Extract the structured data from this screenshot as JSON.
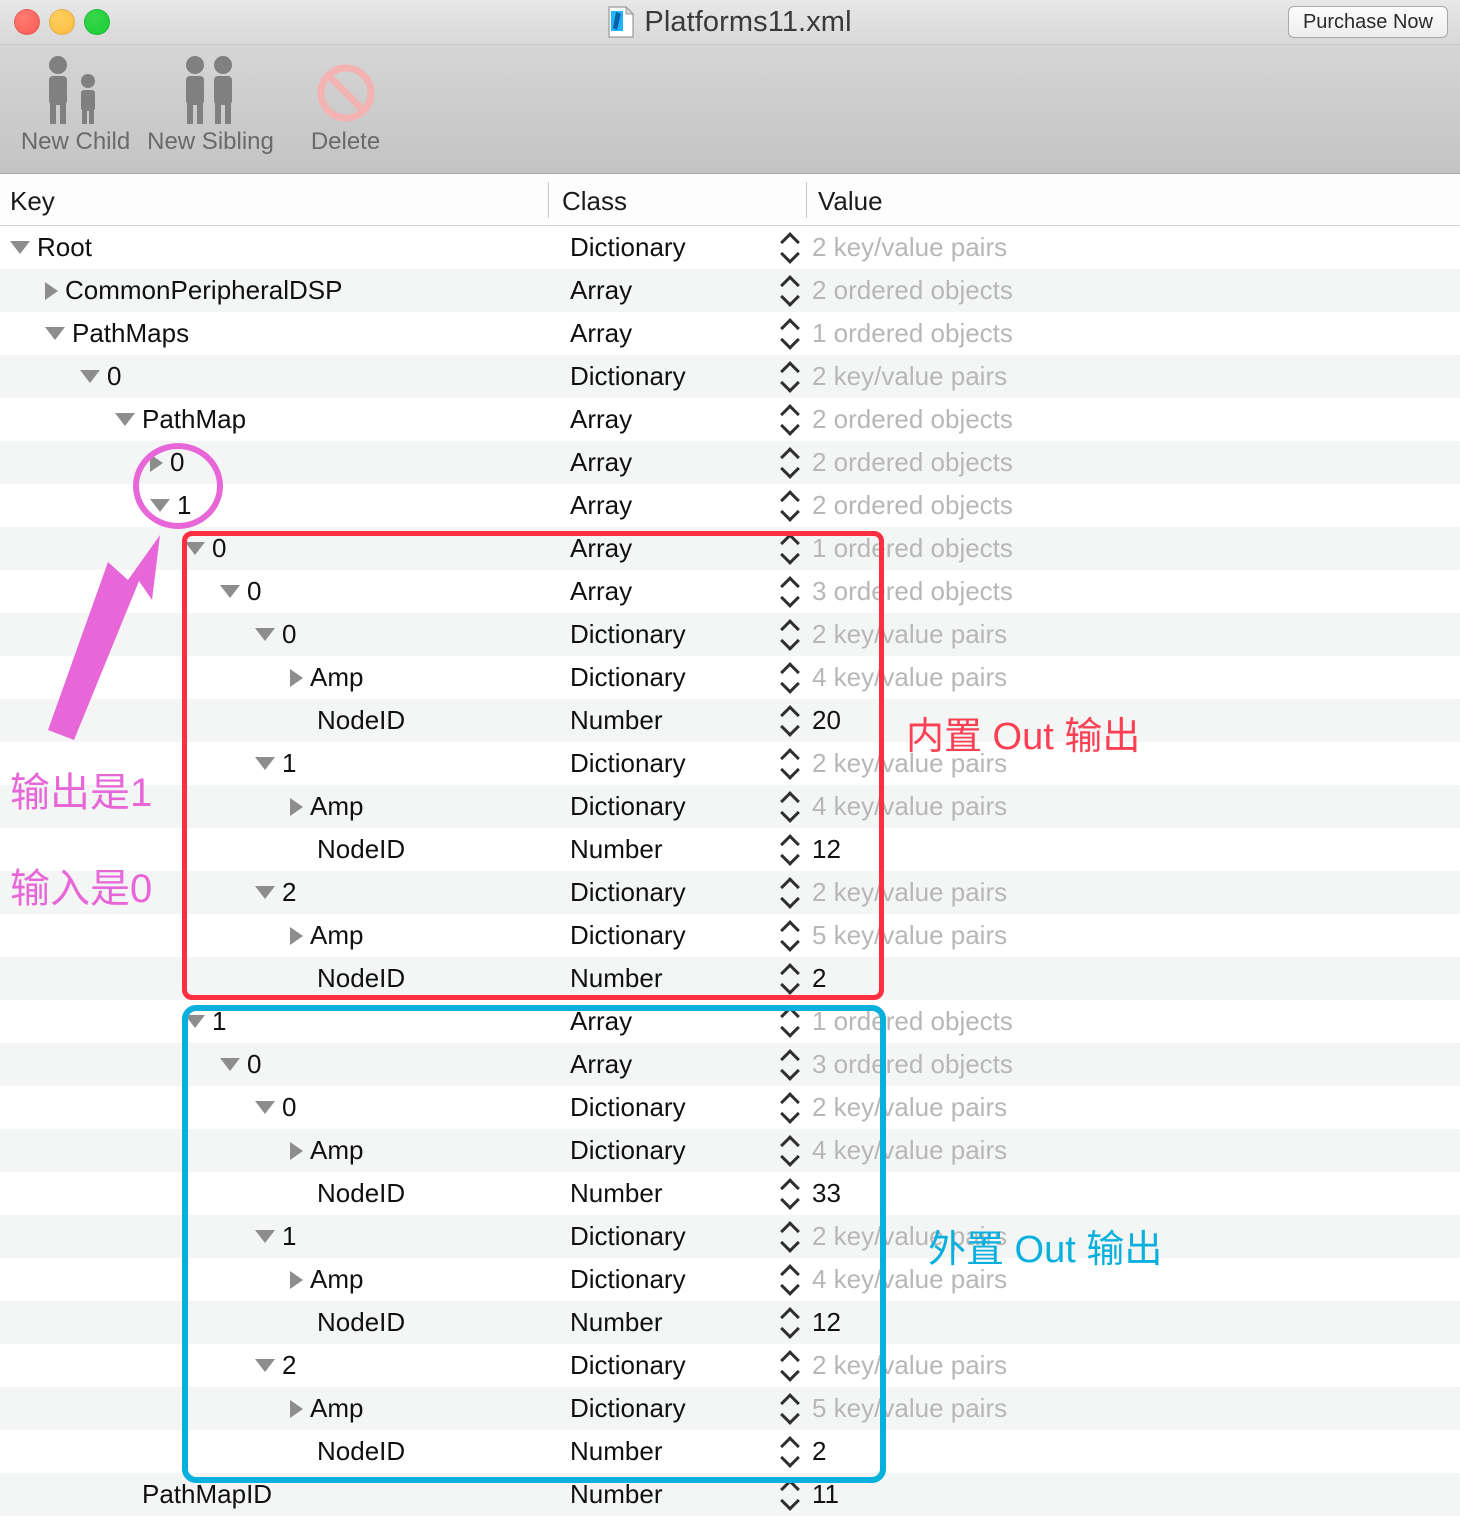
{
  "window": {
    "title": "Platforms11.xml",
    "title_icon": "xml-document-icon",
    "purchase_label": "Purchase Now",
    "traffic_lights": [
      "close-button",
      "minimize-button",
      "zoom-button"
    ]
  },
  "toolbar": {
    "items": [
      {
        "label": "New Child",
        "icon": "two-people-parent-child-icon"
      },
      {
        "label": "New Sibling",
        "icon": "two-people-icon"
      },
      {
        "label": "Delete",
        "icon": "prohibition-sign-icon"
      }
    ]
  },
  "table": {
    "columns": [
      "Key",
      "Class",
      "Value"
    ],
    "rows": [
      {
        "indent": 0,
        "disc": "open",
        "key": "Root",
        "cls": "Dictionary",
        "val": "2 key/value pairs",
        "muted": true,
        "stepper": true
      },
      {
        "indent": 1,
        "disc": "closed",
        "key": "CommonPeripheralDSP",
        "cls": "Array",
        "val": "2 ordered objects",
        "muted": true,
        "stepper": true
      },
      {
        "indent": 1,
        "disc": "open",
        "key": "PathMaps",
        "cls": "Array",
        "val": "1 ordered objects",
        "muted": true,
        "stepper": true
      },
      {
        "indent": 2,
        "disc": "open",
        "key": "0",
        "cls": "Dictionary",
        "val": "2 key/value pairs",
        "muted": true,
        "stepper": true
      },
      {
        "indent": 3,
        "disc": "open",
        "key": "PathMap",
        "cls": "Array",
        "val": "2 ordered objects",
        "muted": true,
        "stepper": true
      },
      {
        "indent": 4,
        "disc": "closed",
        "key": "0",
        "cls": "Array",
        "val": "2 ordered objects",
        "muted": true,
        "stepper": true
      },
      {
        "indent": 4,
        "disc": "open",
        "key": "1",
        "cls": "Array",
        "val": "2 ordered objects",
        "muted": true,
        "stepper": true
      },
      {
        "indent": 5,
        "disc": "open",
        "key": "0",
        "cls": "Array",
        "val": "1 ordered objects",
        "muted": true,
        "stepper": true
      },
      {
        "indent": 6,
        "disc": "open",
        "key": "0",
        "cls": "Array",
        "val": "3 ordered objects",
        "muted": true,
        "stepper": true
      },
      {
        "indent": 7,
        "disc": "open",
        "key": "0",
        "cls": "Dictionary",
        "val": "2 key/value pairs",
        "muted": true,
        "stepper": true
      },
      {
        "indent": 8,
        "disc": "closed",
        "key": "Amp",
        "cls": "Dictionary",
        "val": "4 key/value pairs",
        "muted": true,
        "stepper": true
      },
      {
        "indent": 8,
        "disc": "none",
        "key": "NodeID",
        "cls": "Number",
        "val": "20",
        "muted": false,
        "stepper": true
      },
      {
        "indent": 7,
        "disc": "open",
        "key": "1",
        "cls": "Dictionary",
        "val": "2 key/value pairs",
        "muted": true,
        "stepper": true
      },
      {
        "indent": 8,
        "disc": "closed",
        "key": "Amp",
        "cls": "Dictionary",
        "val": "4 key/value pairs",
        "muted": true,
        "stepper": true
      },
      {
        "indent": 8,
        "disc": "none",
        "key": "NodeID",
        "cls": "Number",
        "val": "12",
        "muted": false,
        "stepper": true
      },
      {
        "indent": 7,
        "disc": "open",
        "key": "2",
        "cls": "Dictionary",
        "val": "2 key/value pairs",
        "muted": true,
        "stepper": true
      },
      {
        "indent": 8,
        "disc": "closed",
        "key": "Amp",
        "cls": "Dictionary",
        "val": "5 key/value pairs",
        "muted": true,
        "stepper": true
      },
      {
        "indent": 8,
        "disc": "none",
        "key": "NodeID",
        "cls": "Number",
        "val": "2",
        "muted": false,
        "stepper": true
      },
      {
        "indent": 5,
        "disc": "open",
        "key": "1",
        "cls": "Array",
        "val": "1 ordered objects",
        "muted": true,
        "stepper": true
      },
      {
        "indent": 6,
        "disc": "open",
        "key": "0",
        "cls": "Array",
        "val": "3 ordered objects",
        "muted": true,
        "stepper": true
      },
      {
        "indent": 7,
        "disc": "open",
        "key": "0",
        "cls": "Dictionary",
        "val": "2 key/value pairs",
        "muted": true,
        "stepper": true
      },
      {
        "indent": 8,
        "disc": "closed",
        "key": "Amp",
        "cls": "Dictionary",
        "val": "4 key/value pairs",
        "muted": true,
        "stepper": true
      },
      {
        "indent": 8,
        "disc": "none",
        "key": "NodeID",
        "cls": "Number",
        "val": "33",
        "muted": false,
        "stepper": true
      },
      {
        "indent": 7,
        "disc": "open",
        "key": "1",
        "cls": "Dictionary",
        "val": "2 key/value pairs",
        "muted": true,
        "stepper": true
      },
      {
        "indent": 8,
        "disc": "closed",
        "key": "Amp",
        "cls": "Dictionary",
        "val": "4 key/value pairs",
        "muted": true,
        "stepper": true
      },
      {
        "indent": 8,
        "disc": "none",
        "key": "NodeID",
        "cls": "Number",
        "val": "12",
        "muted": false,
        "stepper": true
      },
      {
        "indent": 7,
        "disc": "open",
        "key": "2",
        "cls": "Dictionary",
        "val": "2 key/value pairs",
        "muted": true,
        "stepper": true
      },
      {
        "indent": 8,
        "disc": "closed",
        "key": "Amp",
        "cls": "Dictionary",
        "val": "5 key/value pairs",
        "muted": true,
        "stepper": true
      },
      {
        "indent": 8,
        "disc": "none",
        "key": "NodeID",
        "cls": "Number",
        "val": "2",
        "muted": false,
        "stepper": true
      },
      {
        "indent": 3,
        "disc": "none",
        "key": "PathMapID",
        "cls": "Number",
        "val": "11",
        "muted": false,
        "stepper": true
      }
    ]
  },
  "annotations": {
    "red_box_label": "内置 Out 输出",
    "blue_box_label": "外置 Out 输出",
    "pink_label_output": "输出是1",
    "pink_label_input": "输入是0",
    "colors": {
      "red": "#fb2e42",
      "blue": "#09b0dd",
      "pink": "#e766d8"
    }
  }
}
